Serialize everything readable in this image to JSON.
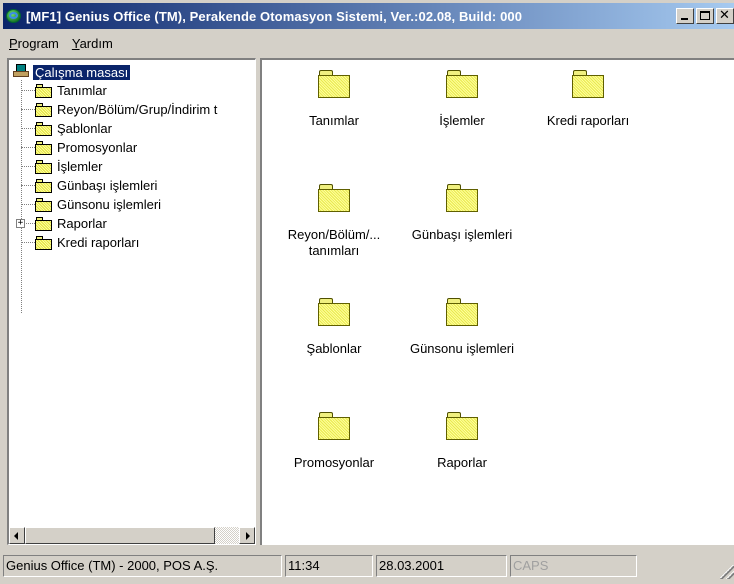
{
  "window": {
    "title": "[MF1] Genius Office (TM), Perakende Otomasyon Sistemi, Ver.:02.08, Build: 000",
    "buttons": {
      "minimize": "minimize-icon",
      "maximize": "maximize-icon",
      "close": "close-icon"
    }
  },
  "menu": {
    "items": [
      {
        "label": "Program",
        "accel": "P"
      },
      {
        "label": "Yardım",
        "accel": "Y"
      }
    ]
  },
  "tree": {
    "root": {
      "label": "Çalışma masası",
      "icon": "desktop-icon",
      "selected": true
    },
    "items": [
      {
        "label": "Tanımlar",
        "expandable": false
      },
      {
        "label": "Reyon/Bölüm/Grup/İndirim t",
        "expandable": false
      },
      {
        "label": "Şablonlar",
        "expandable": false
      },
      {
        "label": "Promosyonlar",
        "expandable": false
      },
      {
        "label": "İşlemler",
        "expandable": false
      },
      {
        "label": "Günbaşı işlemleri",
        "expandable": false
      },
      {
        "label": "Günsonu işlemleri",
        "expandable": false
      },
      {
        "label": "Raporlar",
        "expandable": true,
        "expander": "+"
      },
      {
        "label": "Kredi raporları",
        "expandable": false
      }
    ]
  },
  "icons": {
    "items": [
      {
        "label": "Tanımlar"
      },
      {
        "label": "İşlemler"
      },
      {
        "label": "Kredi raporları"
      },
      {
        "label": "Reyon/Bölüm/...",
        "label2": "tanımları"
      },
      {
        "label": "Günbaşı işlemleri"
      },
      {
        "label": "Şablonlar"
      },
      {
        "label": "Günsonu işlemleri"
      },
      {
        "label": "Promosyonlar"
      },
      {
        "label": "Raporlar"
      }
    ]
  },
  "status": {
    "app": "Genius Office (TM) - 2000, POS A.Ş.",
    "time": "11:34",
    "date": "28.03.2001",
    "caps": "CAPS"
  },
  "colors": {
    "titlebar_start": "#0a246a",
    "titlebar_end": "#a6caf0",
    "selection": "#0a246a",
    "folder": "#ffff99",
    "face": "#d4d0c8"
  }
}
